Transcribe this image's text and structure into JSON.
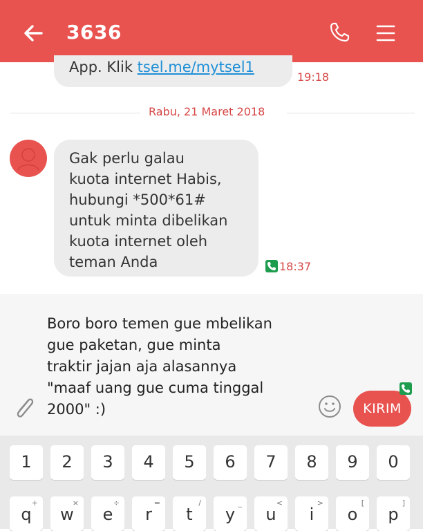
{
  "header": {
    "title": "3636",
    "bg_color": "#e8524f",
    "back_icon": "arrow-left-icon",
    "call_icon": "phone-icon",
    "menu_icon": "menu-icon"
  },
  "messages": [
    {
      "text_before_link": "App. Klik ",
      "link": "tsel.me/mytsel1",
      "time": "19:18"
    },
    {
      "date_separator": "Rabu, 21 Maret 2018"
    },
    {
      "lines": [
        "Gak perlu galau",
        "kuota internet Habis,",
        "hubungi *500*61#",
        "untuk minta dibelikan",
        "kuota internet oleh",
        "teman Anda"
      ],
      "time": "18:37"
    }
  ],
  "compose": {
    "draft_lines": [
      "Boro boro temen gue mbelikan",
      "gue paketan, gue minta",
      "traktir jajan aja alasannya",
      "\"maaf uang gue cuma tinggal",
      "2000\" :)"
    ],
    "send_label": "KIRIM",
    "attach_icon": "paperclip-icon",
    "emoji_icon": "smiley-icon"
  },
  "keyboard": {
    "row1": [
      "1",
      "2",
      "3",
      "4",
      "5",
      "6",
      "7",
      "8",
      "9",
      "0"
    ],
    "row2": [
      {
        "key": "q",
        "sub": "+"
      },
      {
        "key": "w",
        "sub": "×"
      },
      {
        "key": "e",
        "sub": "÷"
      },
      {
        "key": "r",
        "sub": "="
      },
      {
        "key": "t",
        "sub": "/"
      },
      {
        "key": "y",
        "sub": "_"
      },
      {
        "key": "u",
        "sub": "<"
      },
      {
        "key": "i",
        "sub": ">"
      },
      {
        "key": "o",
        "sub": "["
      },
      {
        "key": "p",
        "sub": "]"
      }
    ]
  }
}
